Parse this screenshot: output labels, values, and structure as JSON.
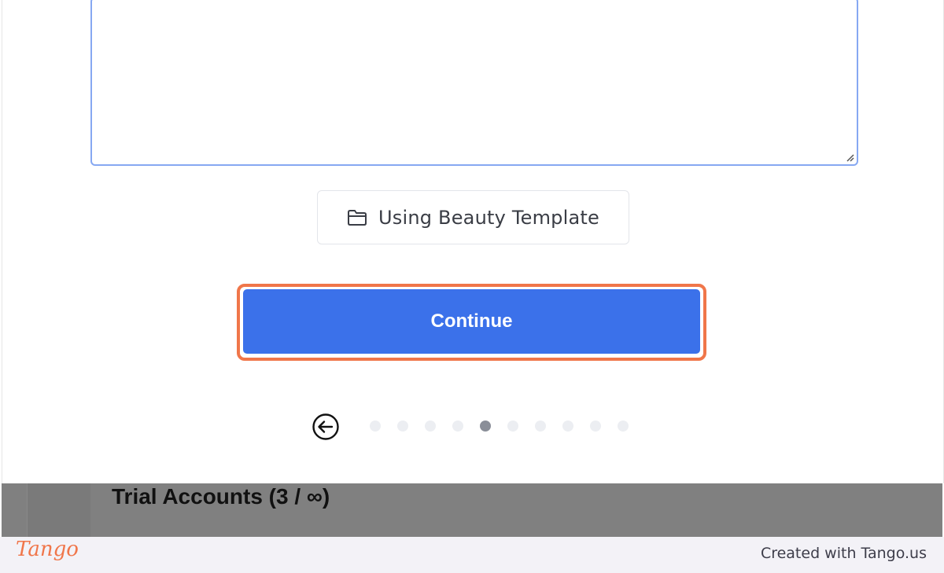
{
  "template_button": {
    "label": "Using Beauty Template",
    "icon": "folder-icon"
  },
  "continue_button": {
    "label": "Continue",
    "color": "#3b71ea",
    "highlight_color": "#f0764a"
  },
  "pagination": {
    "back_icon": "arrow-left-circle-icon",
    "total_steps": 10,
    "current_step": 5
  },
  "background_page": {
    "title": "Trial Accounts (3 / ∞)"
  },
  "footer": {
    "logo": "Tango",
    "created_with": "Created with Tango.us"
  }
}
